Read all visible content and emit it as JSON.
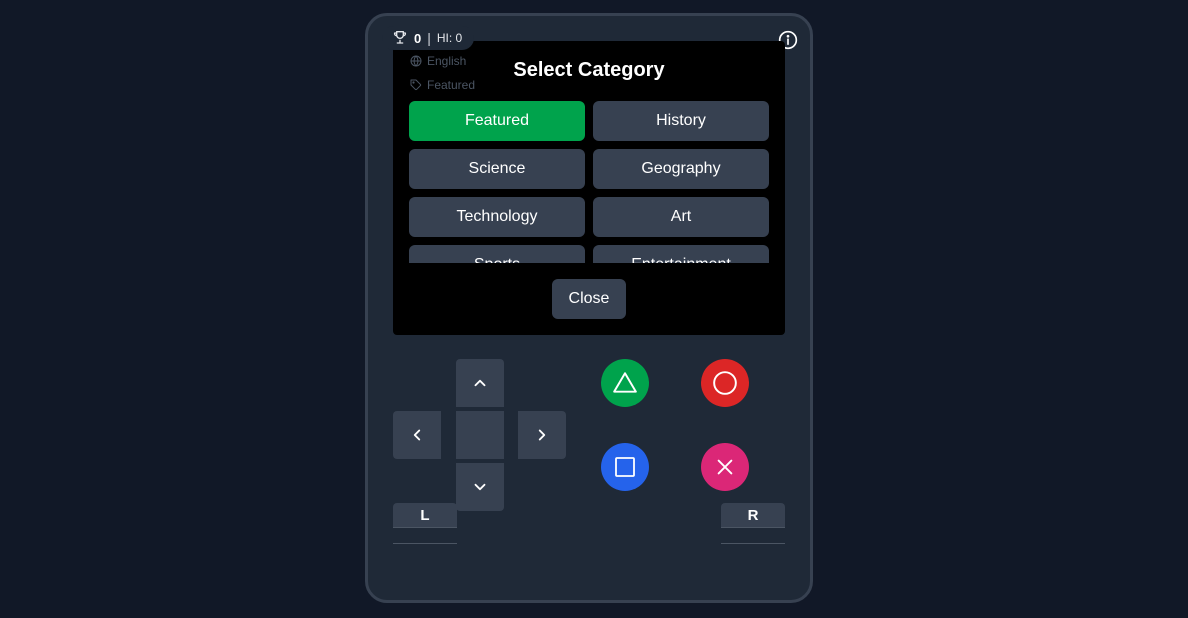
{
  "scoreboard": {
    "score": "0",
    "separator": "|",
    "high_score": "HI: 0"
  },
  "meta": {
    "language": "English",
    "category": "Featured"
  },
  "modal": {
    "title": "Select Category",
    "categories": [
      "Featured",
      "History",
      "Science",
      "Geography",
      "Technology",
      "Art",
      "Sports",
      "Entertainment"
    ],
    "selected": "Featured",
    "close_label": "Close"
  },
  "shoulders": {
    "left": "L",
    "right": "R"
  },
  "icons": {
    "trophy": "trophy-icon",
    "info": "info-icon",
    "globe": "globe-icon",
    "tag": "tag-icon",
    "up": "chevron-up-icon",
    "down": "chevron-down-icon",
    "left": "chevron-left-icon",
    "right": "chevron-right-icon",
    "triangle": "triangle-icon",
    "circle": "circle-icon",
    "square": "square-icon",
    "cross": "cross-icon"
  },
  "colors": {
    "background": "#111827",
    "device": "#1f2937",
    "button": "#374151",
    "selected": "#00a34c",
    "triangle": "#00a34c",
    "circle": "#dc2626",
    "square": "#2563eb",
    "cross": "#db2777"
  }
}
